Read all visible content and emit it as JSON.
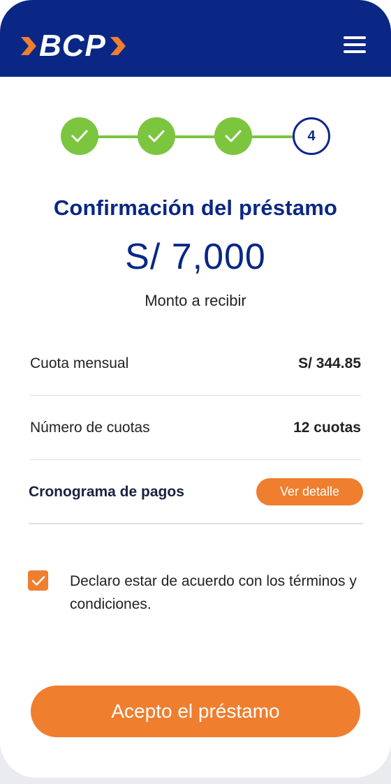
{
  "brand": {
    "name": "BCP",
    "header_color": "#0a2785",
    "accent_color": "#ef7e2f",
    "success_color": "#7cc53f"
  },
  "header": {
    "menu_icon": "hamburger-menu-icon"
  },
  "stepper": {
    "steps": [
      {
        "state": "done",
        "icon": "check-icon"
      },
      {
        "state": "done",
        "icon": "check-icon"
      },
      {
        "state": "done",
        "icon": "check-icon"
      },
      {
        "state": "current",
        "label": "4"
      }
    ]
  },
  "summary": {
    "title": "Confirmación del préstamo",
    "amount": "S/ 7,000",
    "amount_label": "Monto a recibir"
  },
  "details": [
    {
      "label": "Cuota mensual",
      "value": "S/ 344.85"
    },
    {
      "label": "Número de cuotas",
      "value": "12 cuotas"
    }
  ],
  "schedule": {
    "label": "Cronograma de pagos",
    "button_label": "Ver detalle"
  },
  "terms": {
    "checked": true,
    "text": "Declaro estar de acuerdo con los términos y condiciones."
  },
  "cta": {
    "label": "Acepto el préstamo"
  }
}
